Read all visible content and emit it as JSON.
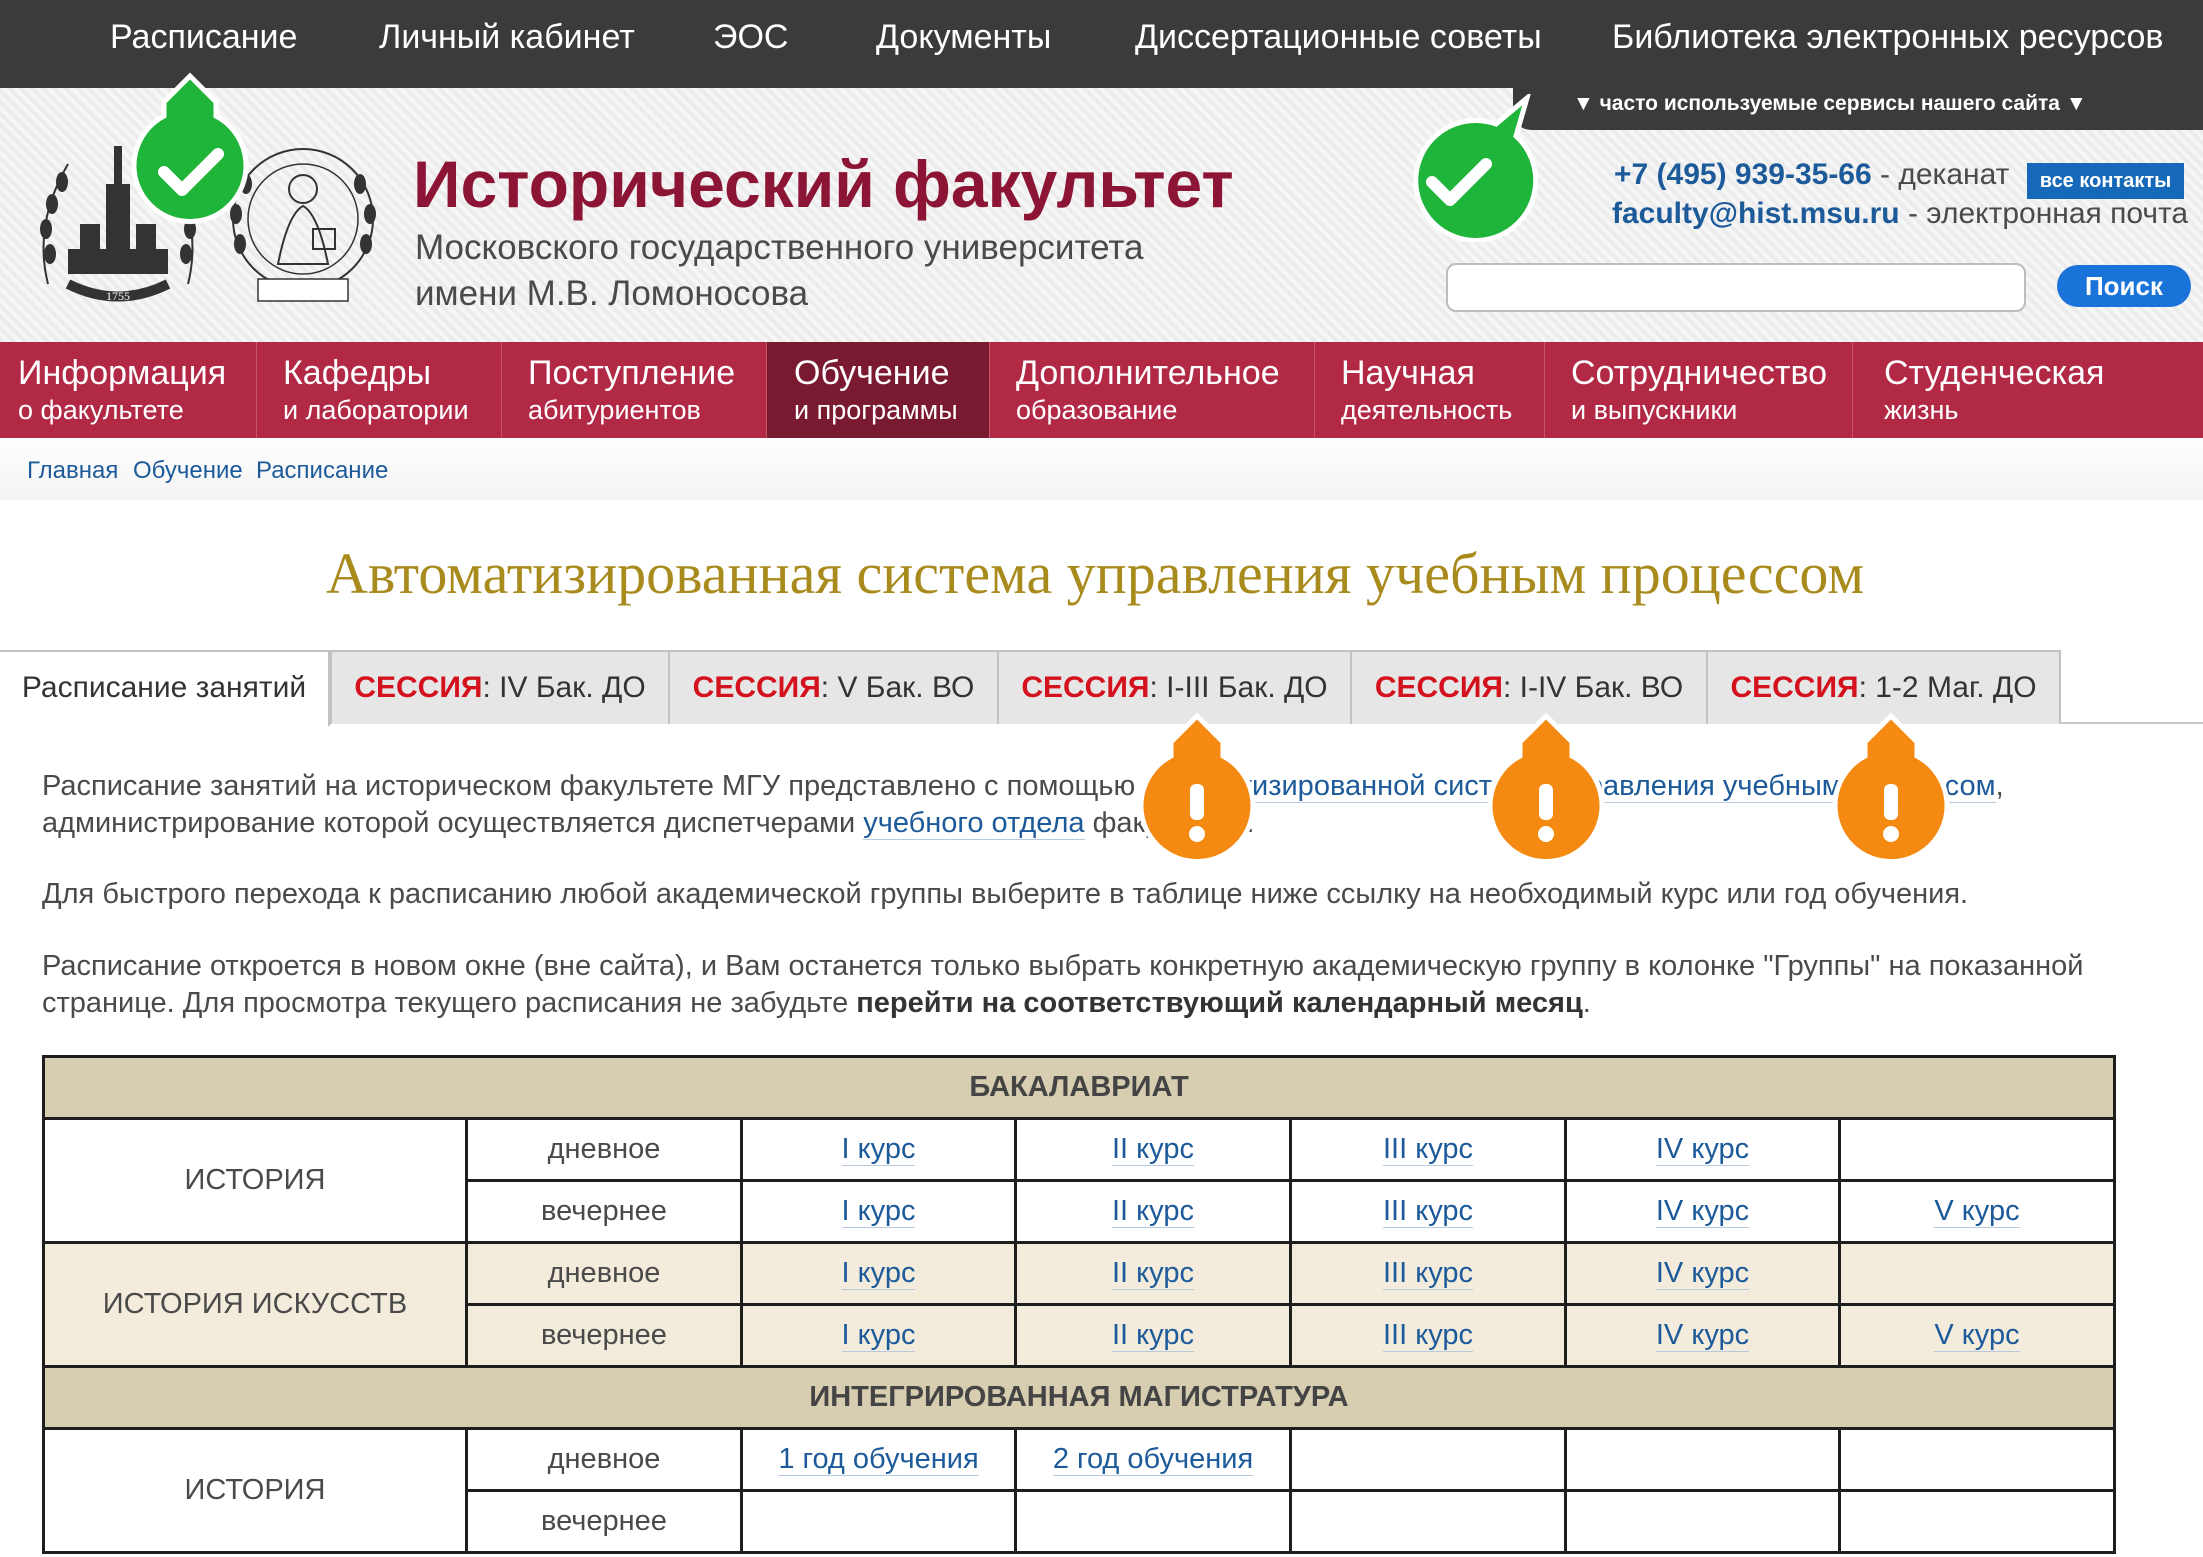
{
  "top_nav": [
    "Расписание",
    "Личный кабинет",
    "ЭОС",
    "Документы",
    "Диссертационные советы",
    "Библиотека электронных ресурсов"
  ],
  "services_label": "▼  часто используемые сервисы нашего сайта  ▼",
  "header": {
    "title": "Исторический факультет",
    "subtitle_line1": "Московского государственного университета",
    "subtitle_line2": "имени М.В. Ломоносова",
    "phone": "+7 (495) 939-35-66",
    "phone_suffix": " - деканат",
    "all_contacts": "все контакты",
    "email": "faculty@hist.msu.ru",
    "email_suffix": " - электронная почта",
    "search_placeholder": "",
    "search_button": "Поиск"
  },
  "main_nav": [
    {
      "l1": "Информация",
      "l2": "о факультете"
    },
    {
      "l1": "Кафедры",
      "l2": "и лаборатории"
    },
    {
      "l1": "Поступление",
      "l2": "абитуриентов"
    },
    {
      "l1": "Обучение",
      "l2": "и программы"
    },
    {
      "l1": "Дополнительное",
      "l2": "образование"
    },
    {
      "l1": "Научная",
      "l2": "деятельность"
    },
    {
      "l1": "Сотрудничество",
      "l2": "и выпускники"
    },
    {
      "l1": "Студенческая",
      "l2": "жизнь"
    }
  ],
  "breadcrumb": [
    "Главная",
    "Обучение",
    "Расписание"
  ],
  "page_title": "Автоматизированная система управления учебным процессом",
  "tabs": {
    "t0": "Расписание занятий",
    "session_word": "СЕССИЯ",
    "t1": ": IV Бак. ДО",
    "t2": ": V Бак. ВО",
    "t3": ": I-III Бак. ДО",
    "t4": ": I-IV Бак. ВО",
    "t5": ": 1-2 Маг. ДО"
  },
  "content": {
    "p1_a": "Расписание занятий на историческом факультете МГУ представлено с помощью ",
    "p1_link": "автоматизированной системы управления учебным процессом",
    "p1_b": ", администрирование которой осуществляется диспетчерами ",
    "p1_link2": "учебного отдела",
    "p1_c": " факультета.",
    "p2": "Для быстрого перехода к расписанию любой академической группы выберите в таблице ниже ссылку на необходимый курс или год обучения.",
    "p3_a": "Расписание откроется в новом окне (вне сайта), и Вам останется только выбрать конкретную академическую группу в колонке \"Группы\" на показанной странице. Для просмотра текущего расписания не забудьте ",
    "p3_bold": "перейти на соответствующий календарный месяц",
    "p3_c": "."
  },
  "table": {
    "bachelor_header": "БАКАЛАВРИАТ",
    "history": "ИСТОРИЯ",
    "art_history": "ИСТОРИЯ ИСКУССТВ",
    "day": "дневное",
    "evening": "вечернее",
    "courses": [
      "I курс",
      "II курс",
      "III курс",
      "IV курс",
      "V курс"
    ],
    "master_header": "ИНТЕГРИРОВАННАЯ МАГИСТРАТУРА",
    "years": [
      "1 год обучения",
      "2 год обучения"
    ]
  },
  "colors": {
    "brand_red": "#b22946",
    "title_red": "#8c1536",
    "title_gold": "#a98a1c",
    "link_blue": "#1c5a9a",
    "session_red": "#d4121e",
    "check_green": "#1fb53a",
    "warn_orange": "#f58a12"
  }
}
